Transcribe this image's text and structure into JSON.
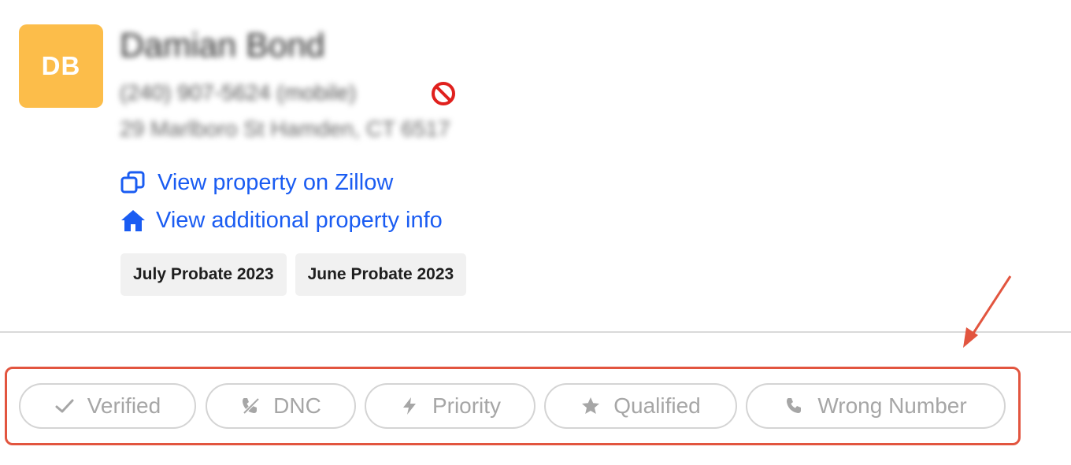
{
  "contact": {
    "initials": "DB",
    "name": "Damian Bond",
    "phone": "(240) 907-5624 (mobile)",
    "address": "29 Marlboro St Hamden, CT 6517"
  },
  "links": {
    "zillow_label": "View property on Zillow",
    "property_info_label": "View additional property info"
  },
  "tags": [
    "July Probate 2023",
    "June Probate 2023"
  ],
  "status_buttons": {
    "verified": "Verified",
    "dnc": "DNC",
    "priority": "Priority",
    "qualified": "Qualified",
    "wrong_number": "Wrong Number"
  },
  "icons": {
    "dnc_flag": "no-entry-icon",
    "zillow": "external-window-icon",
    "property_info": "home-icon",
    "verified": "check-icon",
    "dnc": "phone-slash-icon",
    "priority": "lightning-icon",
    "qualified": "star-icon",
    "wrong_number": "phone-icon"
  },
  "colors": {
    "avatar_bg": "#fcbd4a",
    "link": "#1a5cf2",
    "dnc_flag": "#e0201d",
    "annotation": "#e2553f",
    "pill_text": "#a6a6a6"
  }
}
